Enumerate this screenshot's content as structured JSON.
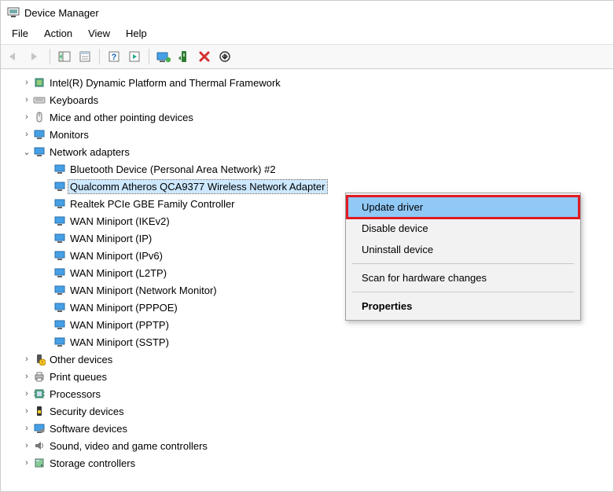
{
  "window": {
    "title": "Device Manager"
  },
  "menu": {
    "file": "File",
    "action": "Action",
    "view": "View",
    "help": "Help"
  },
  "tree": {
    "items": [
      {
        "label": "Intel(R) Dynamic Platform and Thermal Framework",
        "depth": 1,
        "icon": "chip",
        "expand": "closed"
      },
      {
        "label": "Keyboards",
        "depth": 1,
        "icon": "keyboard",
        "expand": "closed"
      },
      {
        "label": "Mice and other pointing devices",
        "depth": 1,
        "icon": "mouse",
        "expand": "closed"
      },
      {
        "label": "Monitors",
        "depth": 1,
        "icon": "monitor",
        "expand": "closed"
      },
      {
        "label": "Network adapters",
        "depth": 1,
        "icon": "monitor",
        "expand": "open"
      },
      {
        "label": "Bluetooth Device (Personal Area Network) #2",
        "depth": 2,
        "icon": "net",
        "expand": "none"
      },
      {
        "label": "Qualcomm Atheros QCA9377 Wireless Network Adapter",
        "depth": 2,
        "icon": "net",
        "expand": "none",
        "selected": true
      },
      {
        "label": "Realtek PCIe GBE Family Controller",
        "depth": 2,
        "icon": "net",
        "expand": "none"
      },
      {
        "label": "WAN Miniport (IKEv2)",
        "depth": 2,
        "icon": "net",
        "expand": "none"
      },
      {
        "label": "WAN Miniport (IP)",
        "depth": 2,
        "icon": "net",
        "expand": "none"
      },
      {
        "label": "WAN Miniport (IPv6)",
        "depth": 2,
        "icon": "net",
        "expand": "none"
      },
      {
        "label": "WAN Miniport (L2TP)",
        "depth": 2,
        "icon": "net",
        "expand": "none"
      },
      {
        "label": "WAN Miniport (Network Monitor)",
        "depth": 2,
        "icon": "net",
        "expand": "none"
      },
      {
        "label": "WAN Miniport (PPPOE)",
        "depth": 2,
        "icon": "net",
        "expand": "none"
      },
      {
        "label": "WAN Miniport (PPTP)",
        "depth": 2,
        "icon": "net",
        "expand": "none"
      },
      {
        "label": "WAN Miniport (SSTP)",
        "depth": 2,
        "icon": "net",
        "expand": "none"
      },
      {
        "label": "Other devices",
        "depth": 1,
        "icon": "warn",
        "expand": "closed"
      },
      {
        "label": "Print queues",
        "depth": 1,
        "icon": "printer",
        "expand": "closed"
      },
      {
        "label": "Processors",
        "depth": 1,
        "icon": "cpu",
        "expand": "closed"
      },
      {
        "label": "Security devices",
        "depth": 1,
        "icon": "security",
        "expand": "closed"
      },
      {
        "label": "Software devices",
        "depth": 1,
        "icon": "software",
        "expand": "closed"
      },
      {
        "label": "Sound, video and game controllers",
        "depth": 1,
        "icon": "sound",
        "expand": "closed"
      },
      {
        "label": "Storage controllers",
        "depth": 1,
        "icon": "storage",
        "expand": "closed"
      }
    ]
  },
  "contextMenu": {
    "update": "Update driver",
    "disable": "Disable device",
    "uninstall": "Uninstall device",
    "scan": "Scan for hardware changes",
    "properties": "Properties"
  }
}
